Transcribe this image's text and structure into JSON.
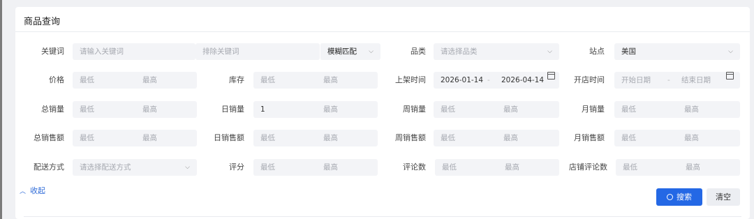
{
  "title": "商品查询",
  "keyword": {
    "label": "关键词",
    "placeholder": "请输入关键词",
    "exclude_placeholder": "排除关键词",
    "match_mode": "模糊匹配"
  },
  "category": {
    "label": "品类",
    "placeholder": "请选择品类"
  },
  "site": {
    "label": "站点",
    "value": "美国"
  },
  "price": {
    "label": "价格",
    "min": "最低",
    "max": "最高"
  },
  "stock": {
    "label": "库存",
    "min": "最低",
    "max": "最高"
  },
  "listing_time": {
    "label": "上架时间",
    "start": "2026-01-14",
    "sep": "-",
    "end": "2026-04-14"
  },
  "open_time": {
    "label": "开店时间",
    "start": "开始日期",
    "sep": "-",
    "end": "结束日期"
  },
  "total_sales": {
    "label": "总销量",
    "min": "最低",
    "max": "最高"
  },
  "daily_sales": {
    "label": "日销量",
    "min_value": "1",
    "max": "最高"
  },
  "weekly_sales": {
    "label": "周销量",
    "min": "最低",
    "max": "最高"
  },
  "monthly_sales": {
    "label": "月销量",
    "min": "最低",
    "max": "最高"
  },
  "total_revenue": {
    "label": "总销售额",
    "min": "最低",
    "max": "最高"
  },
  "daily_revenue": {
    "label": "日销售额",
    "min": "最低",
    "max": "最高"
  },
  "weekly_revenue": {
    "label": "周销售额",
    "min": "最低",
    "max": "最高"
  },
  "monthly_revenue": {
    "label": "月销售额",
    "min": "最低",
    "max": "最高"
  },
  "shipping": {
    "label": "配送方式",
    "placeholder": "请选择配送方式"
  },
  "rating": {
    "label": "评分",
    "min": "最低",
    "max": "最高"
  },
  "reviews": {
    "label": "评论数",
    "min": "最低",
    "max": "最高"
  },
  "shop_reviews": {
    "label": "店铺评论数",
    "min": "最低",
    "max": "最高"
  },
  "collapse_label": "收起",
  "search_label": "搜索",
  "clear_label": "清空",
  "colors": {
    "primary": "#2468e5",
    "input_bg": "#f3f4f7"
  }
}
